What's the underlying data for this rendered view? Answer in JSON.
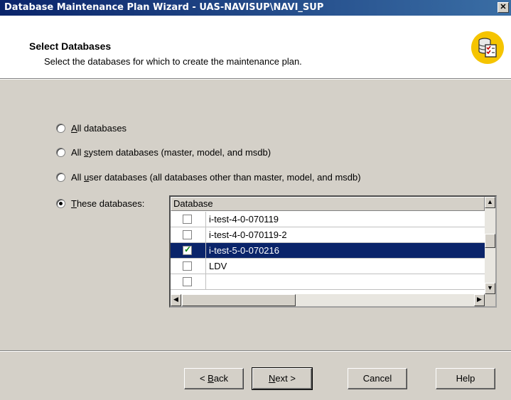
{
  "window": {
    "title": "Database Maintenance Plan Wizard - UAS-NAVISUP\\NAVI_SUP",
    "close_glyph": "✕"
  },
  "header": {
    "heading": "Select Databases",
    "subheading": "Select the databases for which to create the maintenance plan.",
    "icon": "database-checklist-icon"
  },
  "options": [
    {
      "label_prefix": "",
      "accesskey": "A",
      "label_rest": "ll databases",
      "checked": false
    },
    {
      "label_prefix": "All ",
      "accesskey": "s",
      "label_rest": "ystem databases (master, model, and msdb)",
      "checked": false
    },
    {
      "label_prefix": "All ",
      "accesskey": "u",
      "label_rest": "ser databases (all databases other than master, model, and msdb)",
      "checked": false
    },
    {
      "label_prefix": "",
      "accesskey": "T",
      "label_rest": "hese databases:",
      "checked": true
    }
  ],
  "database_list": {
    "column_header": "Database",
    "rows": [
      {
        "name": "i-test-4-0-070119",
        "checked": false,
        "selected": false
      },
      {
        "name": "i-test-4-0-070119-2",
        "checked": false,
        "selected": false
      },
      {
        "name": "i-test-5-0-070216",
        "checked": true,
        "selected": true
      },
      {
        "name": "LDV",
        "checked": false,
        "selected": false
      },
      {
        "name": "",
        "checked": false,
        "selected": false
      }
    ],
    "scroll_up": "▲",
    "scroll_down": "▼",
    "scroll_left": "◀",
    "scroll_right": "▶"
  },
  "buttons": {
    "back": {
      "prefix": "< ",
      "accesskey": "B",
      "rest": "ack"
    },
    "next": {
      "prefix": "",
      "accesskey": "N",
      "rest": "ext >"
    },
    "cancel": "Cancel",
    "help": "Help"
  },
  "colors": {
    "title_bar": "#0a246a",
    "selection": "#0a246a",
    "dialog": "#d4d0c8",
    "icon_bg": "#f5c400"
  }
}
